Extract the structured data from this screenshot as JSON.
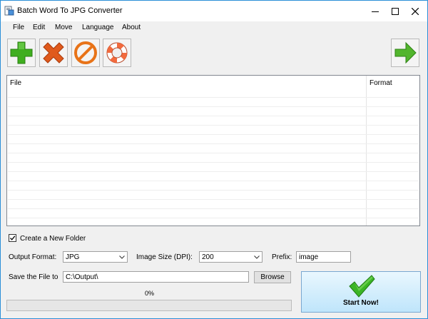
{
  "window": {
    "title": "Batch Word To JPG Converter"
  },
  "menu": [
    "File",
    "Edit",
    "Move",
    "Language",
    "About"
  ],
  "toolbar": {
    "buttons": [
      {
        "icon": "add-icon",
        "color": "#3fae1f"
      },
      {
        "icon": "remove-icon",
        "color": "#e05a1c"
      },
      {
        "icon": "clear-icon",
        "color": "#e87318"
      },
      {
        "icon": "help-lifebuoy-icon",
        "color": "#f26a3d"
      },
      {
        "icon": "next-arrow-icon",
        "color": "#52b52d"
      }
    ]
  },
  "file_list": {
    "columns": [
      "File",
      "Format"
    ],
    "rows": []
  },
  "options": {
    "create_folder_label": "Create a New Folder",
    "create_folder_checked": true,
    "output_format_label": "Output Format:",
    "output_format_value": "JPG",
    "image_size_label": "Image Size (DPI):",
    "image_size_value": "200",
    "prefix_label": "Prefix:",
    "prefix_value": "image",
    "save_label": "Save the File to",
    "save_path": "C:\\Output\\",
    "browse_label": "Browse"
  },
  "progress": {
    "percent_text": "0%",
    "value": 0
  },
  "start": {
    "label": "Start Now!"
  },
  "colors": {
    "accent_border": "#2b8fd8",
    "start_button_top": "#e9f7fe",
    "start_button_bottom": "#bfe5fb",
    "checkmark": "#3bb526"
  }
}
